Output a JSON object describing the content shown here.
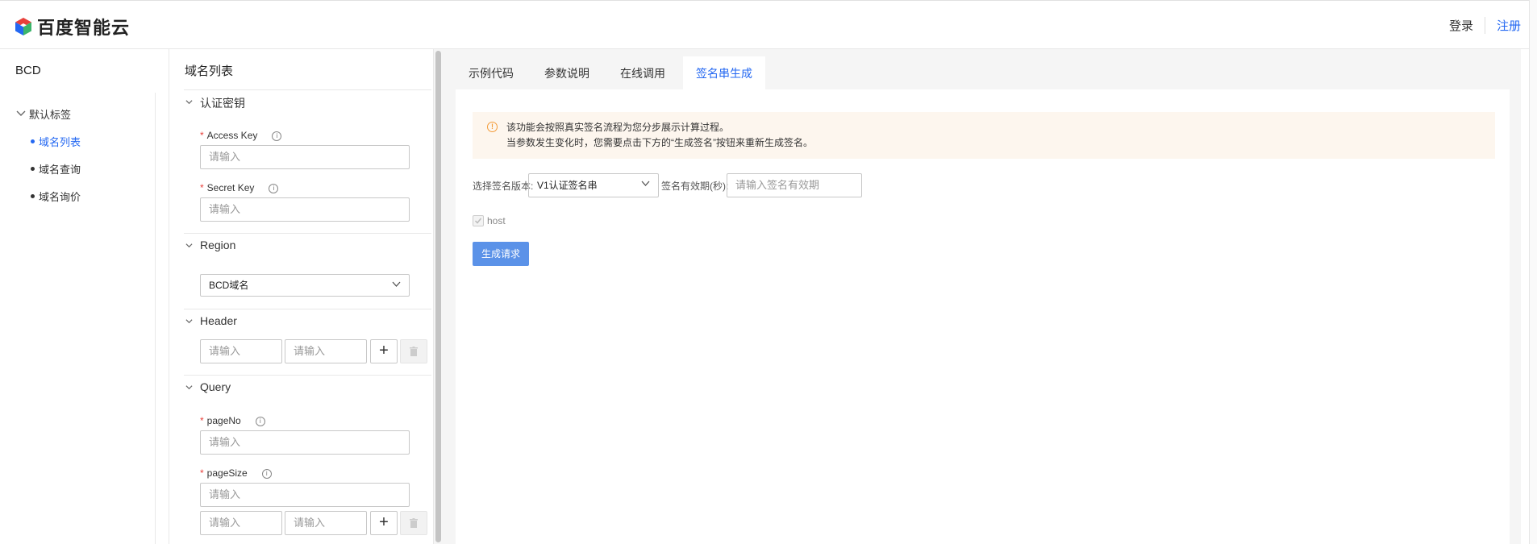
{
  "header": {
    "logo_text": "百度智能云",
    "login": "登录",
    "register": "注册"
  },
  "sidebar": {
    "title": "BCD",
    "group": "默认标签",
    "items": [
      {
        "label": "域名列表",
        "active": true
      },
      {
        "label": "域名查询",
        "active": false
      },
      {
        "label": "域名询价",
        "active": false
      }
    ]
  },
  "form": {
    "pane_title": "域名列表",
    "auth_section": "认证密钥",
    "access_key_label": "Access Key",
    "secret_key_label": "Secret Key",
    "input_placeholder": "请输入",
    "region_section": "Region",
    "region_value": "BCD域名",
    "header_section": "Header",
    "query_section": "Query",
    "page_no_label": "pageNo",
    "page_size_label": "pageSize",
    "add_symbol": "+",
    "info_symbol": "i",
    "required_mark": "*"
  },
  "tabs": [
    {
      "label": "示例代码",
      "active": false
    },
    {
      "label": "参数说明",
      "active": false
    },
    {
      "label": "在线调用",
      "active": false
    },
    {
      "label": "签名串生成",
      "active": true
    }
  ],
  "signature": {
    "notice_line1": "该功能会按照真实签名流程为您分步展示计算过程。",
    "notice_line2": "当参数发生变化时，您需要点击下方的“生成签名”按钮来重新生成签名。",
    "warn_symbol": "!",
    "version_label": "选择签名版本:",
    "version_value": "V1认证签名串",
    "expire_label": "签名有效期(秒):",
    "expire_placeholder": "请输入签名有效期",
    "host_label": "host",
    "generate_button": "生成请求"
  },
  "colors": {
    "accent": "#2468f2",
    "button": "#5b92e8",
    "notice_bg": "#fdf6ee",
    "required": "#e8403b"
  }
}
